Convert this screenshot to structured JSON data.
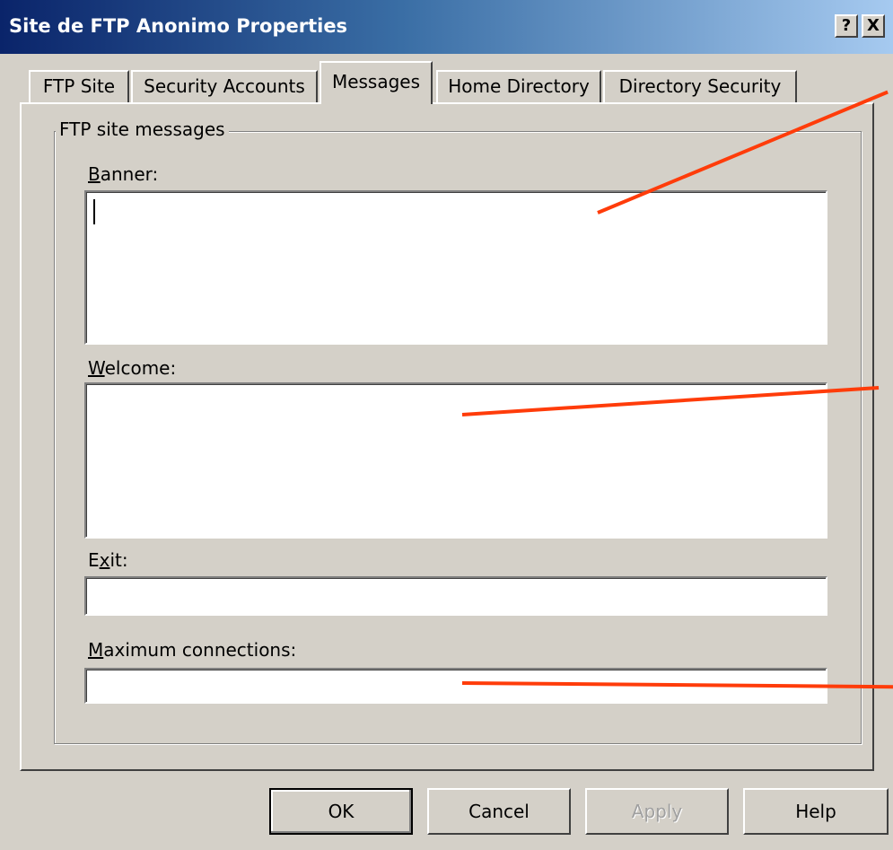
{
  "window": {
    "title": "Site de FTP Anonimo Properties",
    "help_glyph": "?",
    "close_glyph": "X"
  },
  "tabs": [
    {
      "label": "FTP Site",
      "active": false
    },
    {
      "label": "Security Accounts",
      "active": false
    },
    {
      "label": "Messages",
      "active": true
    },
    {
      "label": "Home Directory",
      "active": false
    },
    {
      "label": "Directory Security",
      "active": false
    }
  ],
  "messages": {
    "group_title": "FTP site messages",
    "banner": {
      "label_mnemonic": "B",
      "label_rest": "anner:",
      "value": ""
    },
    "welcome": {
      "label_mnemonic": "W",
      "label_rest": "elcome:",
      "value": ""
    },
    "exit": {
      "label_pre": "E",
      "label_mnemonic": "x",
      "label_rest": "it:",
      "value": ""
    },
    "max_connections": {
      "label_mnemonic": "M",
      "label_rest": "aximum connections:",
      "value": ""
    }
  },
  "buttons": {
    "ok": "OK",
    "cancel": "Cancel",
    "apply": "Apply",
    "help": "Help"
  },
  "colors": {
    "dialog_bg": "#d4d0c8",
    "titlebar_start": "#0a246a",
    "titlebar_end": "#a6caf0",
    "annotation_line": "#ff3c0a"
  }
}
